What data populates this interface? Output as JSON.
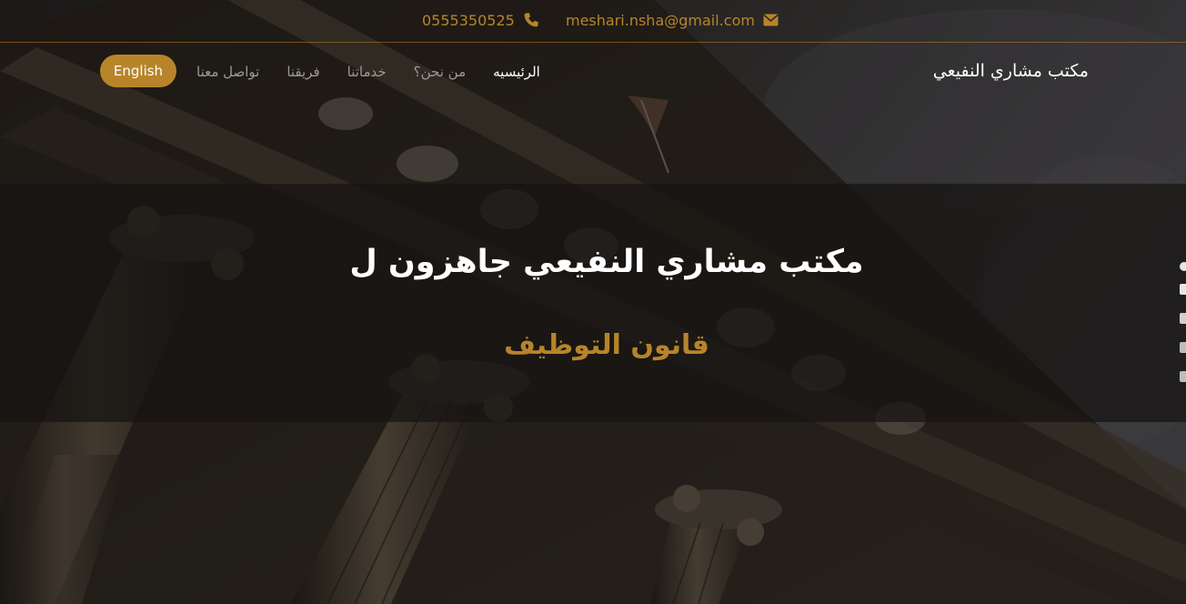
{
  "contact": {
    "email": "meshari.nsha@gmail.com",
    "phone": "0555350525",
    "email_icon": "envelope-icon",
    "phone_icon": "phone-icon"
  },
  "navbar": {
    "brand": "مكتب مشاري النفيعي",
    "links": [
      {
        "label": "الرئيسيه",
        "active": true
      },
      {
        "label": "من نحن؟",
        "active": false
      },
      {
        "label": "خدماتنا",
        "active": false
      },
      {
        "label": "فريقنا",
        "active": false
      },
      {
        "label": "تواصل معنا",
        "active": false
      }
    ],
    "language_button": "English"
  },
  "hero": {
    "title": "مكتب مشاري النفيعي جاهزون ل",
    "subtitle": "قانون التوظيف"
  },
  "colors": {
    "accent": "#b8842a",
    "nav_text": "#9d9a96",
    "white": "#ffffff"
  }
}
